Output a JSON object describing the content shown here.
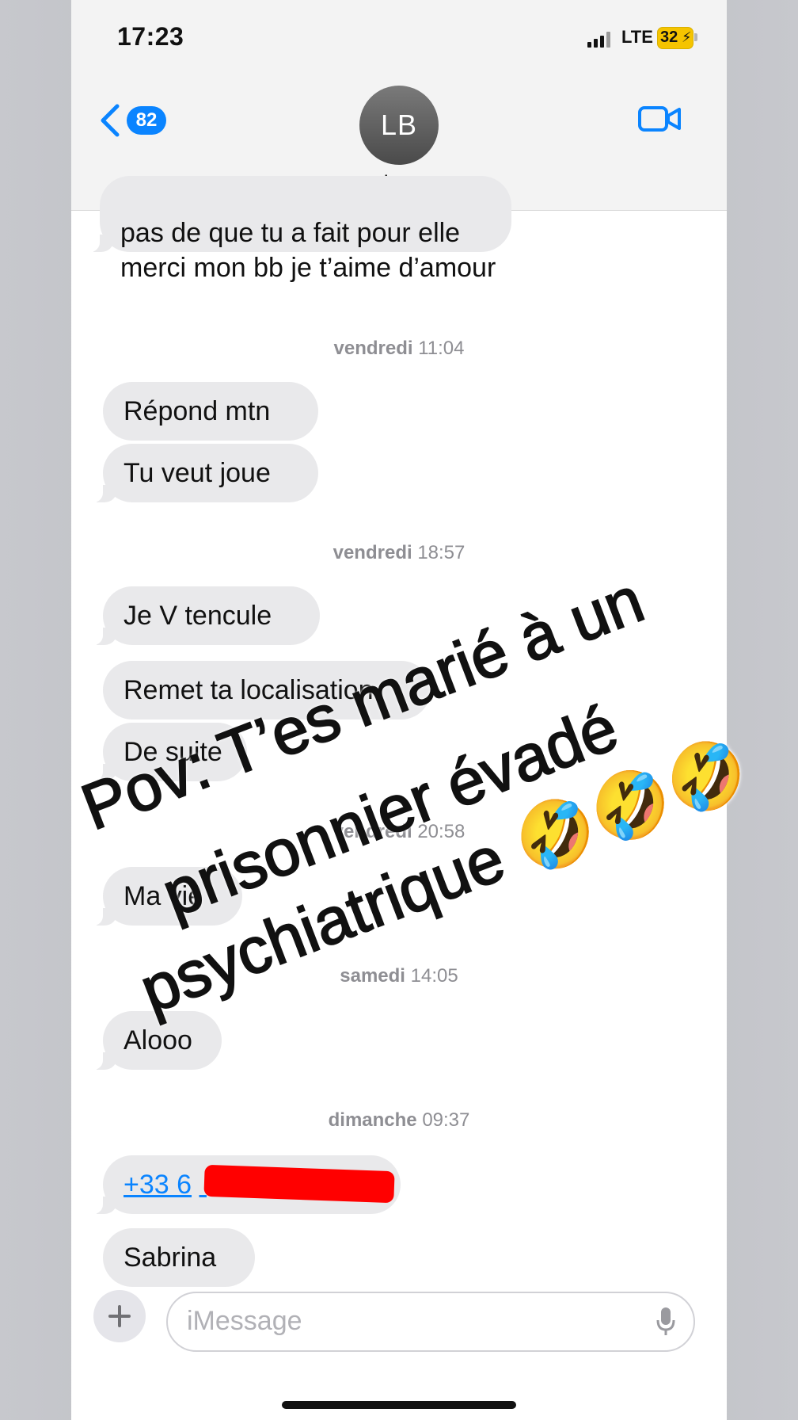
{
  "status_bar": {
    "time": "17:23",
    "network": "LTE",
    "battery": "32"
  },
  "header": {
    "back_count": "82",
    "avatar_initials": "LB",
    "contact_name": "La"
  },
  "messages": [
    {
      "type": "text",
      "lines": [
        "pas de que tu a fait pour elle",
        "merci mon bb je t’aime d’amour"
      ]
    },
    {
      "type": "timestamp",
      "day": "vendredi",
      "time": "11:04"
    },
    {
      "type": "text",
      "text": "Répond mtn"
    },
    {
      "type": "text",
      "text": "Tu veut joue"
    },
    {
      "type": "timestamp",
      "day": "vendredi",
      "time": "18:57"
    },
    {
      "type": "text",
      "text": "Je V tencule"
    },
    {
      "type": "text",
      "text": "Remet ta localisation"
    },
    {
      "type": "text",
      "text": "De suite"
    },
    {
      "type": "timestamp",
      "day": "vendredi",
      "time": "20:58"
    },
    {
      "type": "text",
      "text": "Ma vie"
    },
    {
      "type": "timestamp",
      "day": "samedi",
      "time": "14:05"
    },
    {
      "type": "text",
      "text": "Alooo"
    },
    {
      "type": "timestamp",
      "day": "dimanche",
      "time": "09:37"
    },
    {
      "type": "link",
      "text": "+33 6"
    },
    {
      "type": "text",
      "text": "Sabrina"
    }
  ],
  "input": {
    "placeholder": "iMessage"
  },
  "overlay": {
    "lines": [
      "Pov: T’es marié à un",
      "prisonnier évadé",
      "psychiatrique 🤣🤣🤣"
    ]
  },
  "colors": {
    "accent": "#0a84ff",
    "bubble": "#e9e9eb",
    "redaction": "#ff0000"
  }
}
